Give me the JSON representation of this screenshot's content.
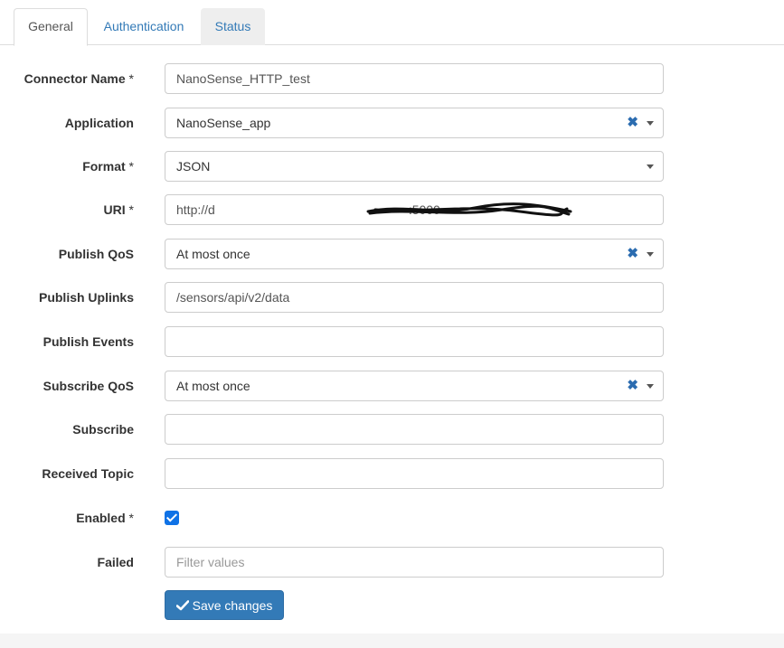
{
  "tabs": [
    {
      "label": "General",
      "active": true
    },
    {
      "label": "Authentication",
      "active": false
    },
    {
      "label": "Status",
      "active": false
    }
  ],
  "form": {
    "connector_name": {
      "label": "Connector Name",
      "required_mark": "*",
      "value": "NanoSense_HTTP_test"
    },
    "application": {
      "label": "Application",
      "value": "NanoSense_app",
      "clear_glyph": "✖"
    },
    "format": {
      "label": "Format",
      "required_mark": "*",
      "value": "JSON"
    },
    "uri": {
      "label": "URI",
      "required_mark": "*",
      "value_prefix": "http://d",
      "value_suffix": ":5000"
    },
    "publish_qos": {
      "label": "Publish QoS",
      "value": "At most once",
      "clear_glyph": "✖"
    },
    "publish_uplinks": {
      "label": "Publish Uplinks",
      "value": "/sensors/api/v2/data"
    },
    "publish_events": {
      "label": "Publish Events",
      "value": ""
    },
    "subscribe_qos": {
      "label": "Subscribe QoS",
      "value": "At most once",
      "clear_glyph": "✖"
    },
    "subscribe": {
      "label": "Subscribe",
      "value": ""
    },
    "received_topic": {
      "label": "Received Topic",
      "value": ""
    },
    "enabled": {
      "label": "Enabled",
      "required_mark": "*",
      "checked": true
    },
    "failed": {
      "label": "Failed",
      "placeholder": "Filter values"
    }
  },
  "actions": {
    "save_label": "Save changes",
    "save_icon": "check-icon"
  },
  "colors": {
    "primary": "#337ab7",
    "checkbox": "#0f72e6",
    "clear": "#2b6cb0",
    "link": "#337ab7"
  }
}
